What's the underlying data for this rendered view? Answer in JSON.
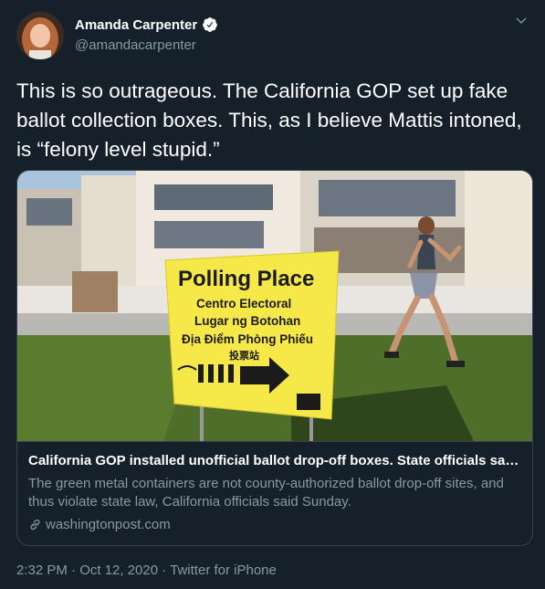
{
  "author": {
    "name": "Amanda Carpenter",
    "handle": "@amandacarpenter"
  },
  "tweet": {
    "text": "This is so outrageous. The California GOP set up fake ballot collection boxes. This, as I believe Mattis intoned, is “felony level stupid.”"
  },
  "card": {
    "image": {
      "sign_title": "Polling Place",
      "sign_line1": "Centro Electoral",
      "sign_line2": "Lugar ng Botohan",
      "sign_line3": "Địa Điểm Phòng Phiếu",
      "sign_line4": "投票站"
    },
    "title": "California GOP installed unofficial ballot drop-off boxes. State officials say t...",
    "description": "The green metal containers are not county-authorized ballot drop-off sites, and thus violate state law, California officials said Sunday.",
    "domain": "washingtonpost.com"
  },
  "meta": {
    "timestamp": "2:32 PM · Oct 12, 2020 · Twitter for iPhone"
  },
  "colors": {
    "background": "#15202b",
    "secondary_text": "#8899a6",
    "border": "#38444d",
    "sign_yellow": "#f7e84a"
  },
  "icons": [
    "verified-badge-icon",
    "chevron-down-icon",
    "link-icon"
  ]
}
